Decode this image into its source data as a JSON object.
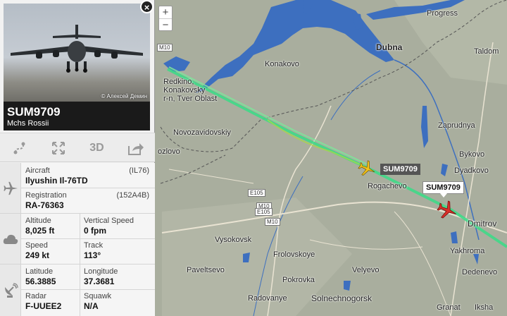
{
  "map": {
    "zoom_in": "+",
    "zoom_out": "−",
    "places": [
      {
        "name": "Progress"
      },
      {
        "name": "Dubna"
      },
      {
        "name": "Taldom"
      },
      {
        "name": "Konakovo"
      },
      {
        "name": "Redkino,"
      },
      {
        "name": "Konakovsky"
      },
      {
        "name": "r-n, Tver Oblast"
      },
      {
        "name": "Novozavidovskiy"
      },
      {
        "name": "Zaprudnya"
      },
      {
        "name": "Bykovo"
      },
      {
        "name": "ozlovo"
      },
      {
        "name": "Dyadkovo"
      },
      {
        "name": "Rogachevo"
      },
      {
        "name": "Dmitrov"
      },
      {
        "name": "Vysokovsk"
      },
      {
        "name": "Frolovskoye"
      },
      {
        "name": "Yakhroma"
      },
      {
        "name": "Paveltsevo"
      },
      {
        "name": "Velyevo"
      },
      {
        "name": "Dedenevo"
      },
      {
        "name": "Pokrovka"
      },
      {
        "name": "Radovanye"
      },
      {
        "name": "Solnechnogorsk"
      },
      {
        "name": "Granat"
      },
      {
        "name": "Iksha"
      }
    ],
    "roads": [
      "M10",
      "E105",
      "M10",
      "E105",
      "M10"
    ],
    "flights": [
      {
        "callsign": "SUM9709",
        "selected": false
      },
      {
        "callsign": "SUM9709",
        "selected": true
      }
    ],
    "colors": {
      "track": "#3fd987",
      "selected_plane": "#d9302a",
      "other_plane": "#f2c21b",
      "water": "#3d6fbf"
    }
  },
  "panel": {
    "close": "×",
    "photo_credit": "© Алексей Демин",
    "callsign": "SUM9709",
    "airline": "Mchs Rossii",
    "toolbar": {
      "route_icon": "route-icon",
      "expand_icon": "expand-icon",
      "three_d": "3D",
      "share_icon": "share-icon"
    },
    "aircraft_label": "Aircraft",
    "aircraft_code": "(IL76)",
    "aircraft_type": "Ilyushin Il-76TD",
    "registration_label": "Registration",
    "registration_code": "(152A4B)",
    "registration": "RA-76363",
    "altitude_label": "Altitude",
    "altitude": "8,025 ft",
    "vspeed_label": "Vertical Speed",
    "vspeed": "0 fpm",
    "speed_label": "Speed",
    "speed": "249 kt",
    "track_label": "Track",
    "track": "113°",
    "latitude_label": "Latitude",
    "latitude": "56.3885",
    "longitude_label": "Longitude",
    "longitude": "37.3681",
    "radar_label": "Radar",
    "radar": "F-UUEE2",
    "squawk_label": "Squawk",
    "squawk": "N/A"
  }
}
